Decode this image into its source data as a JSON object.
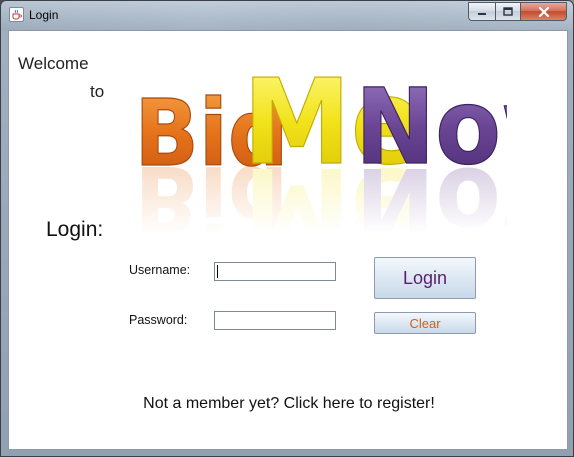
{
  "window": {
    "title": "Login",
    "icon": "java-cup-icon",
    "controls": [
      "minimize-icon",
      "maximize-icon",
      "close-icon"
    ]
  },
  "welcome": {
    "line1": "Welcome",
    "line2": "to"
  },
  "logo": {
    "text": "BidMeNow",
    "parts": [
      {
        "text": "Bid",
        "color": "#e5731a"
      },
      {
        "text": "Me",
        "color": "#f2e21a"
      },
      {
        "text": "Now",
        "color": "#6a4594"
      }
    ]
  },
  "form": {
    "heading": "Login:",
    "username_label": "Username:",
    "username_value": "",
    "password_label": "Password:",
    "password_value": ""
  },
  "buttons": {
    "login": "Login",
    "clear": "Clear"
  },
  "register_link": "Not a member yet? Click here to register!",
  "colors": {
    "login_button_text": "#5a1e6e",
    "clear_button_text": "#c8621a"
  }
}
